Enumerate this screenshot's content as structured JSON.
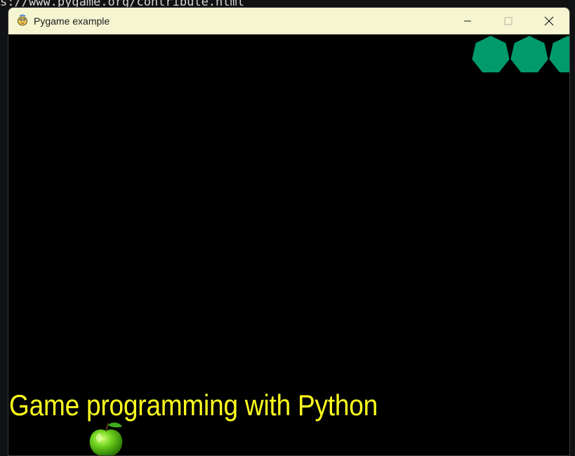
{
  "terminal": {
    "text": "s://www.pygame.org/contribute.html"
  },
  "window": {
    "title": "Pygame example",
    "app_icon": "pygame-snake-icon",
    "controls": {
      "minimize": "minimize-icon",
      "maximize": "maximize-icon",
      "close": "close-icon"
    },
    "titlebar_color": "#f6f5d2"
  },
  "game": {
    "background_color": "#000000",
    "caption": "Game programming with Python",
    "caption_color": "#ffff1e",
    "shapes": {
      "kind": "heptagon",
      "color": "#009a6b",
      "count": 3
    },
    "sprite": "green-apple-icon"
  }
}
